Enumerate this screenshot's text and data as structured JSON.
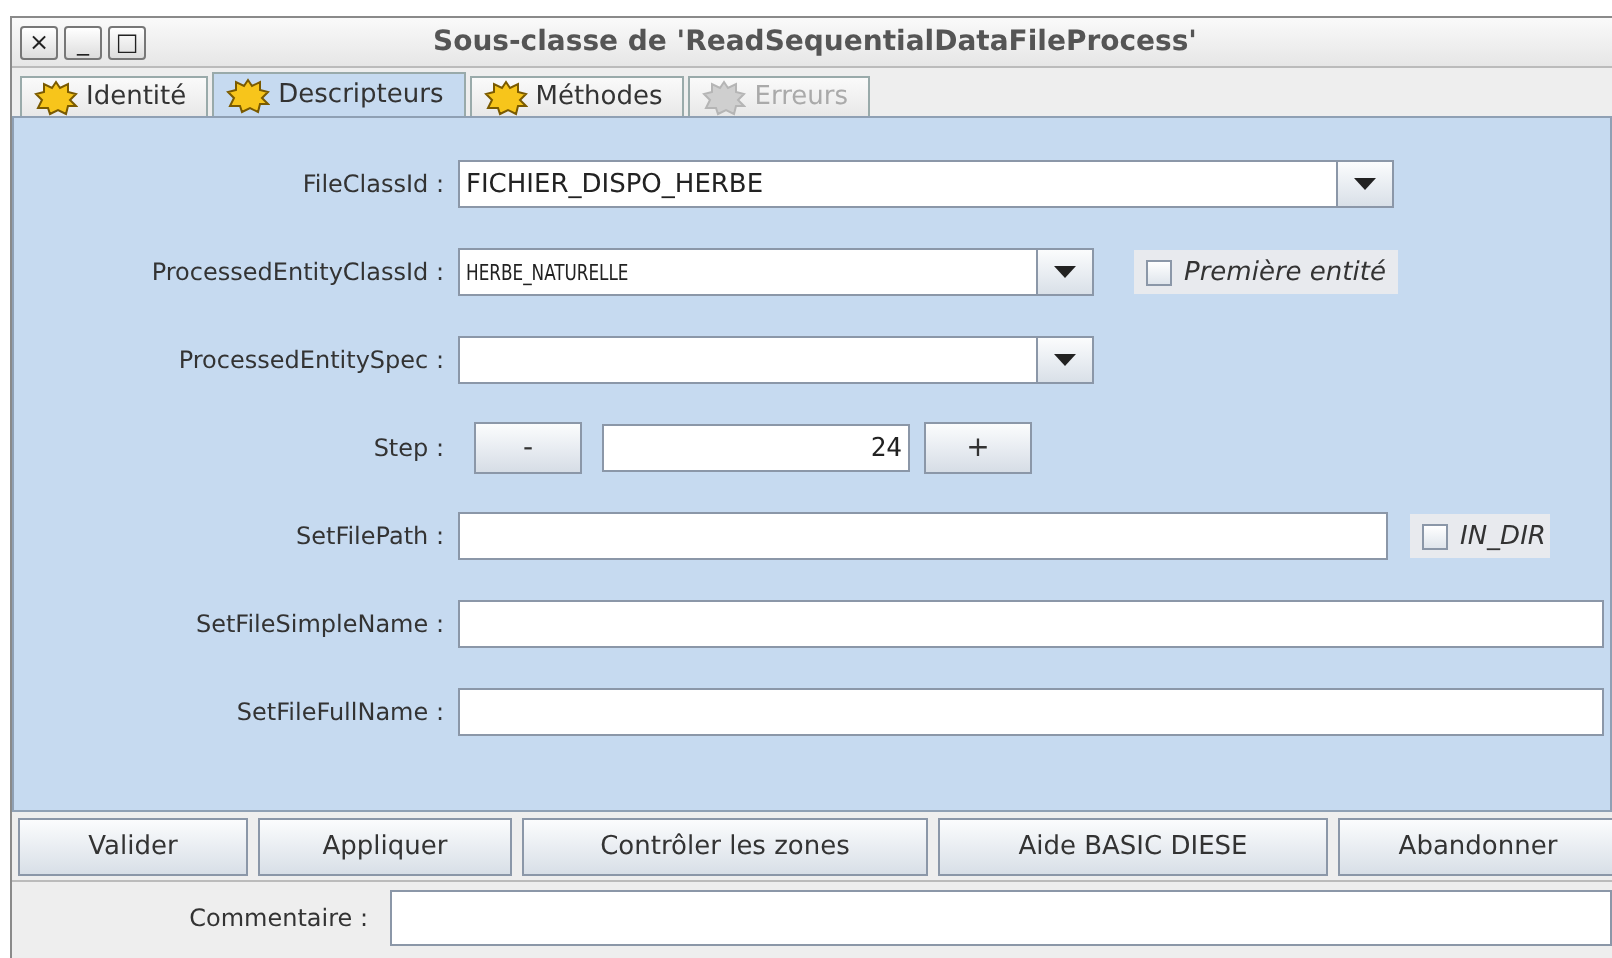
{
  "window": {
    "title": "Sous-classe de 'ReadSequentialDataFileProcess'",
    "controls": [
      "×",
      "_",
      "□"
    ]
  },
  "tabs": [
    {
      "label": "Identité",
      "selected": false,
      "disabled": false
    },
    {
      "label": "Descripteurs",
      "selected": true,
      "disabled": false
    },
    {
      "label": "Méthodes",
      "selected": false,
      "disabled": false
    },
    {
      "label": "Erreurs",
      "selected": false,
      "disabled": true
    }
  ],
  "fields": [
    {
      "kind": "combo",
      "label": "FileClassId :",
      "value": "FICHIER_DISPO_HERBE"
    },
    {
      "kind": "combo",
      "label": "ProcessedEntityClassId :",
      "value": "HERBE_NATURELLE",
      "option": {
        "label": "Première entité",
        "checked": false
      }
    },
    {
      "kind": "combo",
      "label": "ProcessedEntitySpec :"
    },
    {
      "kind": "stepper",
      "label": "Step :",
      "value": "24",
      "minus": "-",
      "plus": "+"
    },
    {
      "kind": "text",
      "label": "SetFilePath :",
      "option": {
        "label": "IN_DIR",
        "checked": false
      }
    },
    {
      "kind": "text",
      "label": "SetFileSimpleName :"
    },
    {
      "kind": "text",
      "label": "SetFileFullName :"
    }
  ],
  "buttons": [
    "Valider",
    "Appliquer",
    "Contrôler les zones",
    "Aide BASIC DIESE",
    "Abandonner"
  ],
  "comment": {
    "label": "Commentaire :"
  }
}
